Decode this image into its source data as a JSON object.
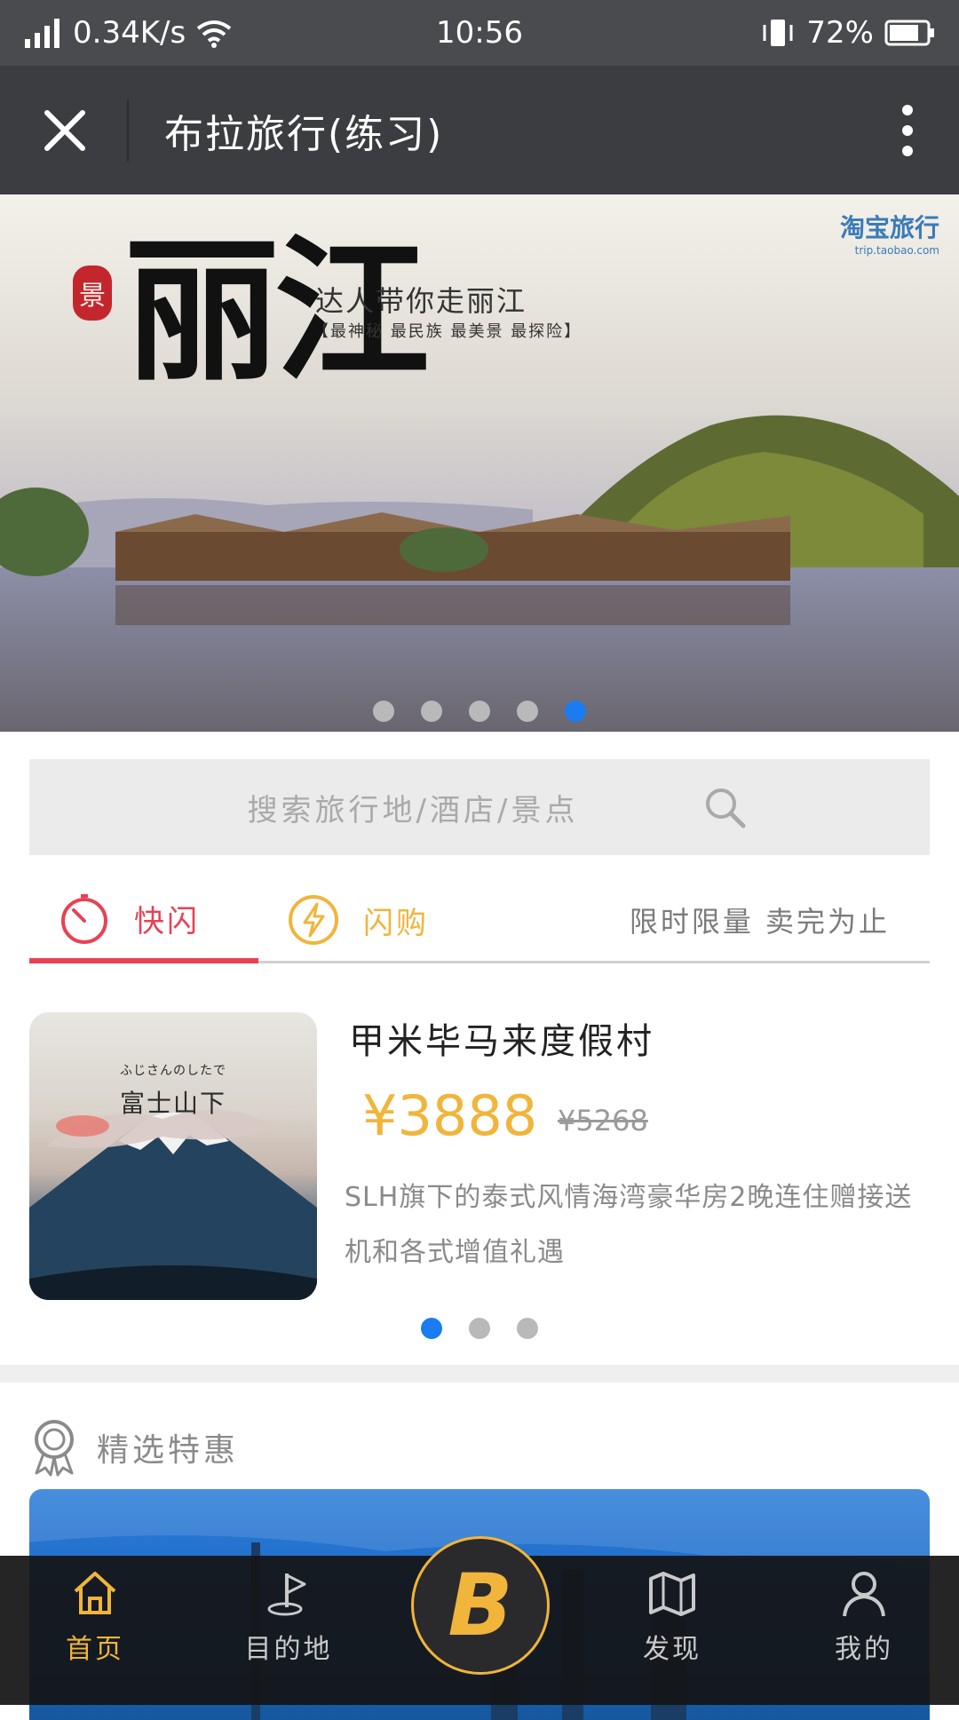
{
  "status_bar": {
    "speed": "0.34K/s",
    "time": "10:56",
    "battery": "72%"
  },
  "titlebar": {
    "title": "布拉旅行(练习)"
  },
  "banner": {
    "headline": "丽江",
    "tagline": "达人带你走丽江",
    "sub_tagline": "【最神秘 最民族 最美景 最探险】",
    "brand": "淘宝旅行",
    "brand_url": "trip.taobao.com",
    "stamp": "景",
    "slide_count": 5,
    "active_slide": 5
  },
  "search": {
    "placeholder": "搜索旅行地/酒店/景点"
  },
  "tabs": {
    "quick": "快闪",
    "flash": "闪购",
    "note": "限时限量 卖完为止"
  },
  "deal": {
    "thumb_caption_small": "ふじさんのしたで",
    "thumb_caption_big": "富士山下",
    "name": "甲米毕马来度假村",
    "price": "¥3888",
    "original_price": "¥5268",
    "description": "SLH旗下的泰式风情海湾豪华房2晚连住赠接送机和各式增值礼遇",
    "page_count": 3,
    "active_page": 1
  },
  "section": {
    "title": "精选特惠"
  },
  "bottom_nav": {
    "home": "首页",
    "destination": "目的地",
    "discover": "发现",
    "mine": "我的",
    "center_logo": "B"
  },
  "colors": {
    "accent_gold": "#f0b53a",
    "accent_red": "#e84155",
    "active_dot": "#1a7cf0"
  }
}
